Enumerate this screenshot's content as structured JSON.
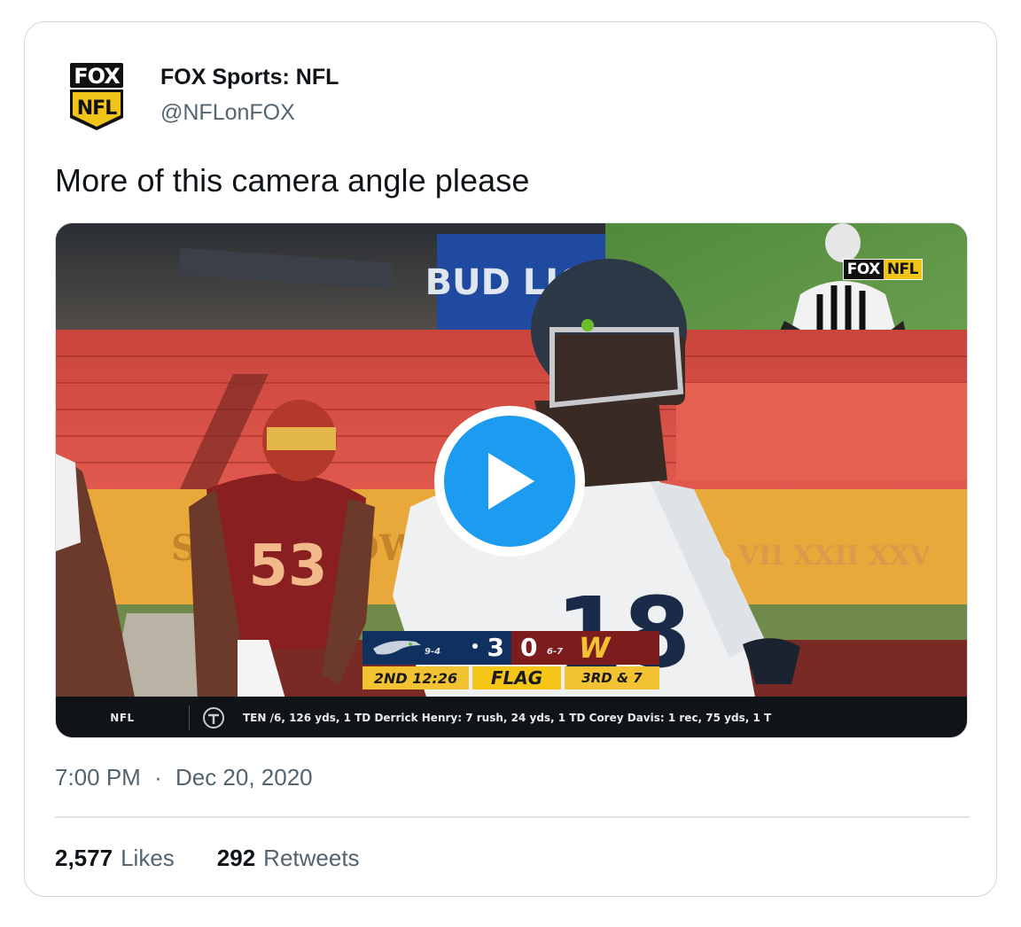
{
  "author": {
    "name": "FOX Sports: NFL",
    "handle": "@NFLonFOX",
    "avatar_logo_top": "FOX",
    "avatar_logo_bottom": "NFL"
  },
  "tweet": {
    "text": "More of this camera angle please",
    "time": "7:00 PM",
    "separator": "·",
    "date": "Dec 20, 2020"
  },
  "video": {
    "broadcast_bug": {
      "fox": "FOX",
      "nfl": "NFL"
    },
    "stadium_ad": "BUD LIGH",
    "banner_left": "SU",
    "banner_mid": "OW",
    "banner_right": "VII  XXII  XXV",
    "player_numbers": {
      "defender": "53",
      "receiver": "18"
    },
    "scoreboard": {
      "away_record": "9-4",
      "away_score": "3",
      "home_record": "6-7",
      "home_score": "0",
      "home_logo": "W",
      "clock": "2ND 12:26",
      "flag": "FLAG",
      "down": "3RD & 7"
    },
    "ticker": {
      "league": "NFL",
      "team": "TEN",
      "stats": "TEN  /6, 126 yds, 1 TD    Derrick Henry: 7 rush, 24 yds, 1 TD    Corey Davis: 1 rec, 75 yds, 1 T"
    },
    "colors": {
      "play_button": "#1d9bf0",
      "seahawks_navy": "#10305f",
      "washington_burgundy": "#7c1c1c",
      "washington_gold": "#f2c232"
    }
  },
  "engagement": {
    "likes_count": "2,577",
    "likes_label": "Likes",
    "retweets_count": "292",
    "retweets_label": "Retweets"
  }
}
